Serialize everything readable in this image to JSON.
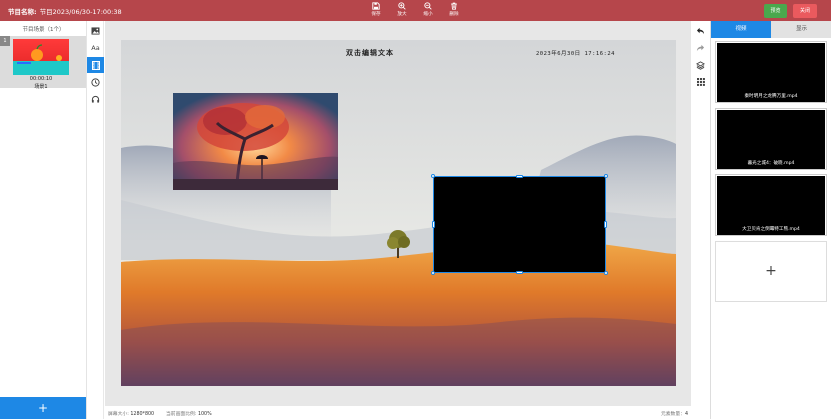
{
  "header": {
    "program_label": "节目名称:",
    "program_name": "节目2023/06/30-17:00:38",
    "tools": [
      {
        "label": "保存",
        "icon": "save-icon"
      },
      {
        "label": "放大",
        "icon": "zoom-in-icon"
      },
      {
        "label": "缩小",
        "icon": "zoom-out-icon"
      },
      {
        "label": "删除",
        "icon": "trash-icon"
      }
    ],
    "preview_label": "预览",
    "close_label": "关闭"
  },
  "scenes": {
    "heading": "节目场景（1个）",
    "items": [
      {
        "index": "1",
        "duration": "00:00:10",
        "name": "场景1"
      }
    ],
    "add_label": "+"
  },
  "element_tools": [
    {
      "name": "image-icon"
    },
    {
      "name": "text-icon",
      "label": "Aa"
    },
    {
      "name": "video-icon",
      "active": true
    },
    {
      "name": "clock-icon"
    },
    {
      "name": "audio-icon"
    }
  ],
  "canvas": {
    "title_text": "双击编辑文本",
    "clock_text": "2023年6月30日 17:16:24"
  },
  "status": {
    "screen_size_label": "屏幕大小:",
    "screen_size_value": "1280*800",
    "zoom_label": "当前画面比例:",
    "zoom_value": "100%",
    "element_count_label": "元素数量：",
    "element_count_value": "4"
  },
  "media_panel": {
    "tabs": [
      {
        "label": "视频",
        "active": true
      },
      {
        "label": "显示",
        "active": false
      }
    ],
    "videos": [
      {
        "name": "秦时明月之龙腾万里.mp4"
      },
      {
        "name": "暮光之城4：破晓.mp4"
      },
      {
        "name": "大卫贝肯之倒霉特工熊.mp4"
      }
    ],
    "add_label": "+"
  },
  "colors": {
    "header_bg": "#b6464b",
    "accent_blue": "#1e88e5",
    "preview_green": "#4aa84d",
    "close_red": "#ea5a5e"
  }
}
